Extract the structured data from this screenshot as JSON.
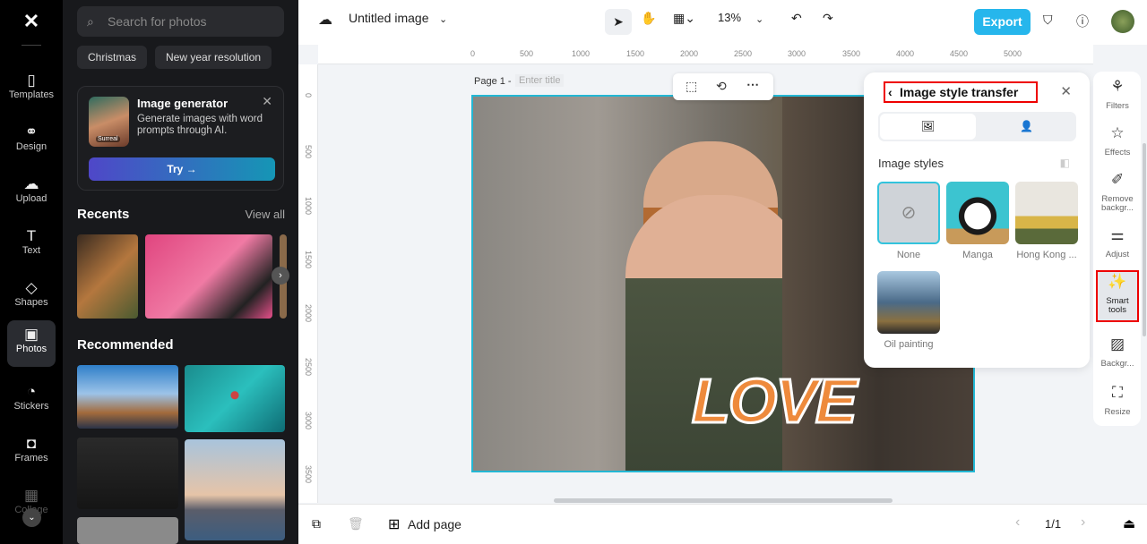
{
  "rail": {
    "items": [
      {
        "label": "Templates",
        "icon": "▯"
      },
      {
        "label": "Design",
        "icon": "⚭"
      },
      {
        "label": "Upload",
        "icon": "☁"
      },
      {
        "label": "Text",
        "icon": "T"
      },
      {
        "label": "Shapes",
        "icon": "◇"
      },
      {
        "label": "Photos",
        "icon": "▣"
      },
      {
        "label": "Stickers",
        "icon": "◔"
      },
      {
        "label": "Frames",
        "icon": "◘"
      },
      {
        "label": "Collage",
        "icon": "▦"
      }
    ]
  },
  "panel": {
    "search_placeholder": "Search for photos",
    "chips": [
      "Christmas",
      "New year resolution"
    ],
    "generator": {
      "title": "Image generator",
      "desc": "Generate images with word prompts through AI.",
      "badge": "Surreal",
      "try": "Try →"
    },
    "recents": "Recents",
    "view_all": "View all",
    "recommended": "Recommended"
  },
  "top": {
    "title": "Untitled image",
    "zoom": "13%",
    "export": "Export"
  },
  "ruler": {
    "top": [
      "0",
      "500",
      "1000",
      "1500",
      "2000",
      "2500",
      "3000",
      "3500",
      "4000",
      "4500",
      "5000"
    ],
    "left": [
      "0",
      "500",
      "1000",
      "1500",
      "2000",
      "2500",
      "3000",
      "3500"
    ]
  },
  "page": {
    "label": "Page 1 -",
    "title_placeholder": "Enter title",
    "text": "LOVE"
  },
  "style_panel": {
    "title": "Image style transfer",
    "section": "Image styles",
    "styles": [
      "None",
      "Manga",
      "Hong Kong ...",
      "Oil painting"
    ]
  },
  "right_tools": [
    "Filters",
    "Effects",
    "Remove backgr...",
    "Adjust",
    "Smart tools",
    "Backgr...",
    "Resize"
  ],
  "bottom": {
    "add_page": "Add page",
    "pages": "1/1"
  },
  "colors": {
    "accent": "#26b6ec",
    "highlight": "#e00000"
  }
}
